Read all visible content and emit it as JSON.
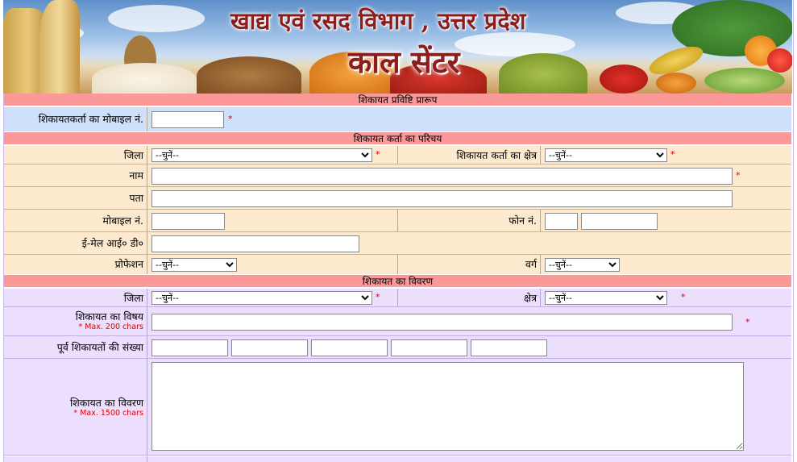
{
  "banner": {
    "title": "खाद्य एवं रसद विभाग , उत्तर प्रदेश",
    "subtitle": "काल सेंटर"
  },
  "sections": {
    "entry_form": "शिकायत प्रविष्टि प्रारूप",
    "complainant_intro": "शिकायत कर्ता का परिचय",
    "complaint_details": "शिकायत का विवरण"
  },
  "form": {
    "complainant_mobile_label": "शिकायतकर्ता का मोबाइल नं.",
    "district_label": "जिला",
    "complainant_area_label": "शिकायत कर्ता का क्षेत्र",
    "name_label": "नाम",
    "address_label": "पता",
    "mobile_label": "मोबाइल नं.",
    "phone_label": "फोन नं.",
    "email_label": "ई-मेल आई० डी०",
    "profession_label": "प्रोफेशन",
    "category_label": "वर्ग",
    "complaint_district_label": "जिला",
    "complaint_area_label": "क्षेत्र",
    "subject_label": "शिकायत का विषय",
    "subject_hint": "* Max. 200 chars",
    "previous_count_label": "पूर्व शिकायतों की संख्या",
    "description_label": "शिकायत का विवरण",
    "description_hint": "* Max. 1500 chars",
    "select_placeholder": "--चुनें--",
    "required_mark": "*"
  },
  "colors": {
    "section_header": "#fb9999",
    "blue_row": "#cfe0fb",
    "peach_row": "#fde9cd",
    "lavender_row": "#ecdefd",
    "required": "#e00000",
    "banner_title": "#8c1d1d"
  }
}
